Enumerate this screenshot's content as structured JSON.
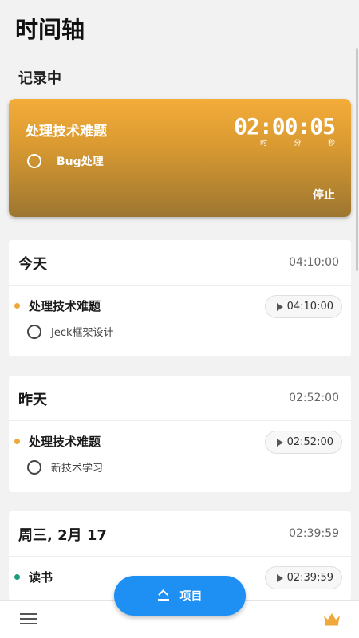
{
  "page": {
    "title": "时间轴"
  },
  "recording": {
    "label": "记录中",
    "project": "处理技术难题",
    "task": "Bug处理",
    "timer": "02:00:05",
    "units": [
      "时",
      "分",
      "秒"
    ],
    "stop_label": "停止"
  },
  "days": [
    {
      "title": "今天",
      "total": "04:10:00",
      "project": {
        "name": "处理技术难题",
        "time": "04:10:00",
        "color": "#f0a83a"
      },
      "task": "Jeck框架设计"
    },
    {
      "title": "昨天",
      "total": "02:52:00",
      "project": {
        "name": "处理技术难题",
        "time": "02:52:00",
        "color": "#f0a83a"
      },
      "task": "新技术学习"
    },
    {
      "title": "周三, 2月 17",
      "total": "02:39:59",
      "project": {
        "name": "读书",
        "time": "02:39:59",
        "color": "#1c9a7a"
      },
      "task": ""
    }
  ],
  "fab": {
    "label": "项目",
    "icon": "collapse-up-icon"
  },
  "bottom_bar": {
    "left_icon": "menu-icon",
    "right_icon": "crown-icon",
    "accent": "#f0a83a"
  }
}
